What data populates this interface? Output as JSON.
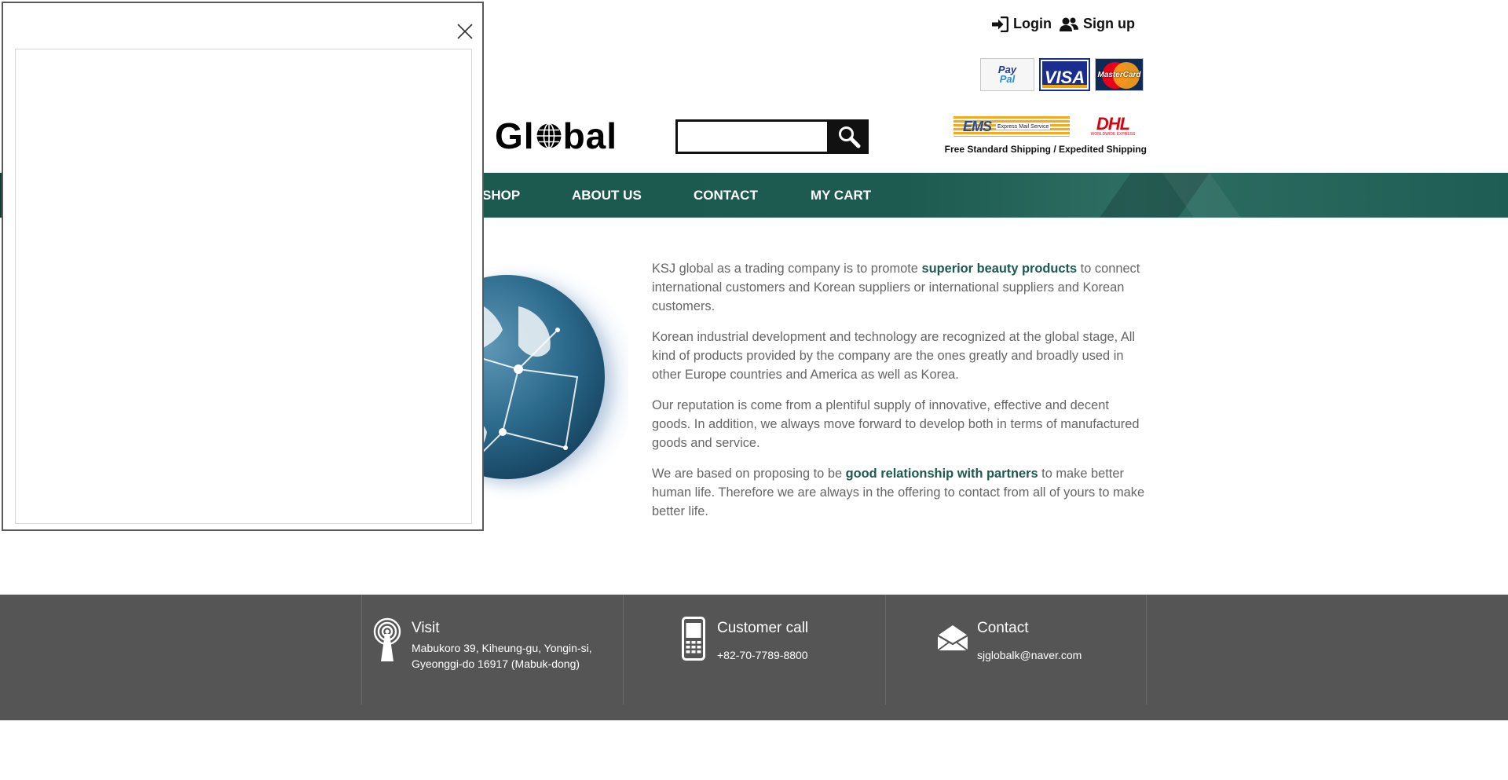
{
  "header": {
    "login_label": "Login",
    "signup_label": "Sign up",
    "payments": {
      "paypal_part1": "Pay",
      "paypal_part2": "Pal",
      "visa": "VISA",
      "mastercard": "MasterCard"
    },
    "logo_prefix": "Gl",
    "logo_suffix": "bal",
    "search": {
      "placeholder": "",
      "value": ""
    },
    "shipping": {
      "ems": "EMS",
      "ems_sub": "Express Mail Service",
      "dhl": "DHL",
      "dhl_sub": "WORLDWIDE EXPRESS",
      "text": "Free Standard Shipping / Expedited Shipping"
    }
  },
  "nav": {
    "items": [
      {
        "label": "SHOP"
      },
      {
        "label": "ABOUT US"
      },
      {
        "label": "CONTACT"
      },
      {
        "label": "MY CART"
      }
    ]
  },
  "main": {
    "p1_before": "KSJ global as a trading company is to promote ",
    "p1_bold": "superior beauty products",
    "p1_after": " to connect international customers and Korean suppliers or international suppliers and Korean customers.",
    "p2": "Korean industrial development and technology are recognized at the global stage, All kind of products provided by the company are the ones greatly and broadly used in other Europe countries and America as well as Korea.",
    "p3": "Our reputation is come from a plentiful supply of innovative, effective and decent goods. In addition, we always move forward to develop both in terms of manufactured goods and service.",
    "p4_before": "We are based on proposing to be ",
    "p4_bold": "good relationship with partners",
    "p4_after": " to make better human life. Therefore we are always in the offering to contact from all of yours to make better life."
  },
  "footer": {
    "visit": {
      "title": "Visit",
      "line1": "Mabukoro 39, Kiheung-gu, Yongin-si,",
      "line2": "Gyeonggi-do 16917 (Mabuk-dong)"
    },
    "call": {
      "title": "Customer call",
      "phone": "+82-70-7789-8800"
    },
    "contact": {
      "title": "Contact",
      "email": "sjglobalk@naver.com"
    }
  },
  "colors": {
    "brand_green": "#1c5a50",
    "footer_bg": "#555555",
    "body_text": "#666666"
  },
  "icons": [
    "sign-in-icon",
    "users-icon",
    "search-icon",
    "close-icon",
    "antenna-icon",
    "mobile-phone-icon",
    "envelope-icon",
    "globe-icon"
  ]
}
